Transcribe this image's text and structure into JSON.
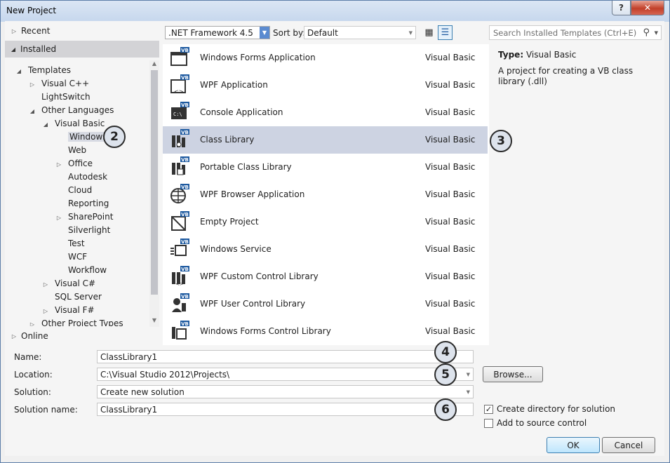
{
  "window": {
    "title": "New Project",
    "help_label": "?",
    "close_label": "✕"
  },
  "left_pane": {
    "recent": "Recent",
    "installed": "Installed",
    "online": "Online",
    "tree": [
      {
        "label": "Templates",
        "level": 0,
        "arrow": "open"
      },
      {
        "label": "Visual C++",
        "level": 1,
        "arrow": "closed"
      },
      {
        "label": "LightSwitch",
        "level": 1,
        "arrow": "none"
      },
      {
        "label": "Other Languages",
        "level": 1,
        "arrow": "open"
      },
      {
        "label": "Visual Basic",
        "level": 2,
        "arrow": "open"
      },
      {
        "label": "Windows",
        "level": 3,
        "arrow": "none",
        "selected": true
      },
      {
        "label": "Web",
        "level": 3,
        "arrow": "none"
      },
      {
        "label": "Office",
        "level": 3,
        "arrow": "closed"
      },
      {
        "label": "Autodesk",
        "level": 3,
        "arrow": "none"
      },
      {
        "label": "Cloud",
        "level": 3,
        "arrow": "none"
      },
      {
        "label": "Reporting",
        "level": 3,
        "arrow": "none"
      },
      {
        "label": "SharePoint",
        "level": 3,
        "arrow": "closed"
      },
      {
        "label": "Silverlight",
        "level": 3,
        "arrow": "none"
      },
      {
        "label": "Test",
        "level": 3,
        "arrow": "none"
      },
      {
        "label": "WCF",
        "level": 3,
        "arrow": "none"
      },
      {
        "label": "Workflow",
        "level": 3,
        "arrow": "none"
      },
      {
        "label": "Visual C#",
        "level": 2,
        "arrow": "closed"
      },
      {
        "label": "SQL Server",
        "level": 2,
        "arrow": "none"
      },
      {
        "label": "Visual F#",
        "level": 2,
        "arrow": "closed"
      },
      {
        "label": "Other Project Types",
        "level": 1,
        "arrow": "closed"
      }
    ]
  },
  "toolbar": {
    "framework": ".NET Framework 4.5",
    "sort_label": "Sort by:",
    "sort_value": "Default",
    "search_placeholder": "Search Installed Templates (Ctrl+E)"
  },
  "templates": [
    {
      "name": "Windows Forms Application",
      "lang": "Visual Basic",
      "icon": "windows-forms-icon"
    },
    {
      "name": "WPF Application",
      "lang": "Visual Basic",
      "icon": "wpf-app-icon"
    },
    {
      "name": "Console Application",
      "lang": "Visual Basic",
      "icon": "console-icon"
    },
    {
      "name": "Class Library",
      "lang": "Visual Basic",
      "icon": "class-library-icon",
      "selected": true
    },
    {
      "name": "Portable Class Library",
      "lang": "Visual Basic",
      "icon": "portable-library-icon"
    },
    {
      "name": "WPF Browser Application",
      "lang": "Visual Basic",
      "icon": "browser-app-icon"
    },
    {
      "name": "Empty Project",
      "lang": "Visual Basic",
      "icon": "empty-project-icon"
    },
    {
      "name": "Windows Service",
      "lang": "Visual Basic",
      "icon": "windows-service-icon"
    },
    {
      "name": "WPF Custom Control Library",
      "lang": "Visual Basic",
      "icon": "custom-control-icon"
    },
    {
      "name": "WPF User Control Library",
      "lang": "Visual Basic",
      "icon": "user-control-icon"
    },
    {
      "name": "Windows Forms Control Library",
      "lang": "Visual Basic",
      "icon": "forms-control-icon"
    }
  ],
  "info": {
    "type_label": "Type:",
    "type_value": "Visual Basic",
    "description": "A project for creating a VB class library (.dll)"
  },
  "form": {
    "name_label": "Name:",
    "name_value": "ClassLibrary1",
    "location_label": "Location:",
    "location_value": "C:\\Visual Studio 2012\\Projects\\",
    "solution_label": "Solution:",
    "solution_value": "Create new solution",
    "solution_name_label": "Solution name:",
    "solution_name_value": "ClassLibrary1",
    "browse": "Browse...",
    "create_dir": "Create directory for solution",
    "create_dir_checked": true,
    "source_control": "Add to source control",
    "source_control_checked": false,
    "ok": "OK",
    "cancel": "Cancel"
  },
  "callouts": [
    "2",
    "3",
    "4",
    "5",
    "6"
  ]
}
